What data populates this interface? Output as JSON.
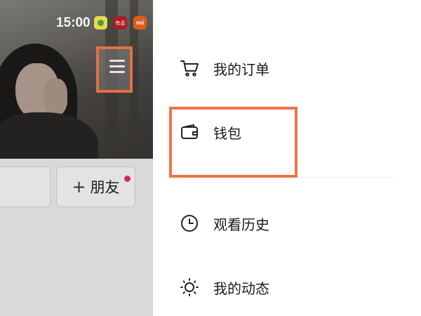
{
  "status_bar": {
    "time": "15:00",
    "app_icons": [
      "green-leaf-app-icon",
      "red-app-icon",
      "mi-app-icon"
    ],
    "red_icon_text": "有品",
    "mi_icon_text": "mi"
  },
  "profile": {
    "add_friend_label": "朋友",
    "add_friend_symbol": "+"
  },
  "drawer": {
    "items": [
      {
        "label": "我的订单",
        "icon": "cart-icon"
      },
      {
        "label": "钱包",
        "icon": "wallet-icon"
      },
      {
        "label": "观看历史",
        "icon": "clock-icon"
      },
      {
        "label": "我的动态",
        "icon": "sun-icon"
      }
    ]
  },
  "colors": {
    "highlight": "#ef7446",
    "notification_dot": "#d93050"
  }
}
